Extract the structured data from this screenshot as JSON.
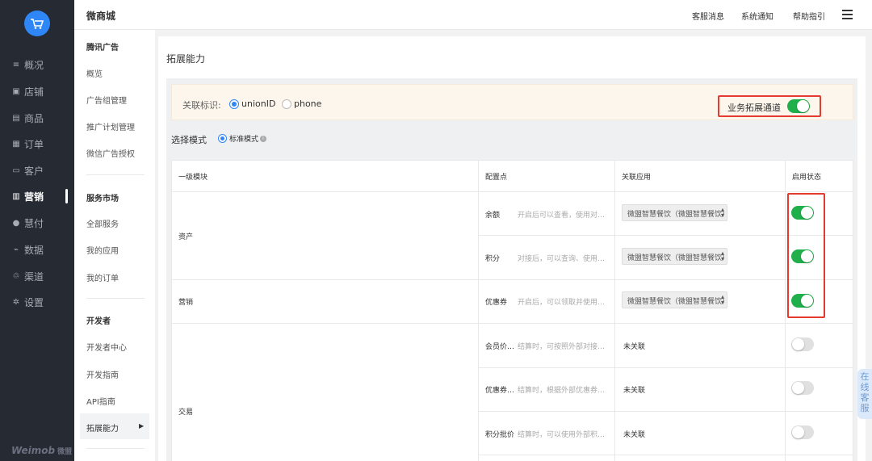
{
  "nav": {
    "items": [
      {
        "icon": "overview-icon",
        "label": "概况"
      },
      {
        "icon": "store-icon",
        "label": "店铺"
      },
      {
        "icon": "goods-icon",
        "label": "商品"
      },
      {
        "icon": "order-icon",
        "label": "订单"
      },
      {
        "icon": "customer-icon",
        "label": "客户"
      },
      {
        "icon": "marketing-icon",
        "label": "营销"
      },
      {
        "icon": "huifu-icon",
        "label": "慧付"
      },
      {
        "icon": "data-icon",
        "label": "数据"
      },
      {
        "icon": "channel-icon",
        "label": "渠道"
      },
      {
        "icon": "settings-icon",
        "label": "设置"
      }
    ],
    "active_index": 5,
    "brand": "Weimob",
    "brand_cn": "微盟"
  },
  "header": {
    "title": "微商城",
    "links": [
      "客服消息",
      "系统通知",
      "帮助指引"
    ]
  },
  "subnav": {
    "groups": [
      {
        "title": "腾讯广告",
        "items": [
          "概览",
          "广告组管理",
          "推广计划管理",
          "微信广告授权"
        ]
      },
      {
        "title": "服务市场",
        "items": [
          "全部服务",
          "我的应用",
          "我的订单"
        ]
      },
      {
        "title": "开发者",
        "items": [
          "开发者中心",
          "开发指南",
          "API指南",
          "拓展能力"
        ]
      }
    ],
    "active_item": "拓展能力"
  },
  "main": {
    "page_title": "拓展能力",
    "assoc": {
      "label": "关联标识:",
      "options": [
        "unionID",
        "phone"
      ],
      "selected": "unionID",
      "biz_channel_label": "业务拓展通道",
      "biz_channel_on": true
    },
    "mode": {
      "label": "选择模式",
      "option": "标准模式"
    },
    "table": {
      "headers": [
        "一级模块",
        "配置点",
        "关联应用",
        "启用状态"
      ],
      "categories": [
        "资产",
        "营销",
        "交易"
      ],
      "rows": [
        {
          "name": "余额",
          "desc": "开启后可以查看，使用对应应用的余额",
          "app": "微盟智慧餐饮（微盟智慧餐饮）",
          "enabled": true
        },
        {
          "name": "积分",
          "desc": "对接后，可以查询、使用对应应用积分",
          "app": "微盟智慧餐饮（微盟智慧餐饮）",
          "enabled": true
        },
        {
          "name": "优惠券",
          "desc": "开启后，可以领取并使用对应优惠券",
          "app": "微盟智慧餐饮（微盟智慧餐饮）",
          "enabled": true
        },
        {
          "name": "会员价…",
          "desc": "结算时，可按照外部对接的会员价",
          "app": "未关联",
          "enabled": false
        },
        {
          "name": "优惠券…",
          "desc": "结算时，根据外部优惠券进行核销",
          "app": "未关联",
          "enabled": false
        },
        {
          "name": "积分批价",
          "desc": "结算时，可以使用外部积分抵扣",
          "app": "未关联",
          "enabled": false
        }
      ]
    }
  },
  "online_service": "在线客服",
  "colors": {
    "nav_bg": "#262a33",
    "accent_blue": "#2f86f6",
    "toggle_on": "#20b04b",
    "highlight_red": "#e53a2f"
  }
}
